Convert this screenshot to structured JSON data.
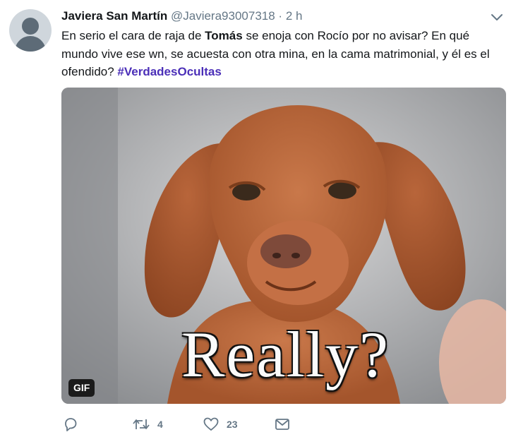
{
  "tweet": {
    "author_name": "Javiera San Martín",
    "author_handle": "@Javiera93007318",
    "separator": "·",
    "time": "2 h",
    "text_1": "En serio el cara de raja de ",
    "text_bold": "Tomás",
    "text_2": " se enoja con Rocío por no avisar? En qué mundo vive ese wn, se acuesta con otra mina, en la cama matrimonial, y él es el ofendido? ",
    "hashtag": "#VerdadesOcultas"
  },
  "media": {
    "caption": "Really?",
    "badge": "GIF"
  },
  "actions": {
    "reply_icon": "reply-icon",
    "retweet_icon": "retweet-icon",
    "retweet_count": "4",
    "like_icon": "heart-icon",
    "like_count": "23",
    "message_icon": "envelope-icon"
  },
  "colors": {
    "hashtag": "#4b2fb8",
    "secondary": "#657786",
    "text": "#14171a"
  }
}
